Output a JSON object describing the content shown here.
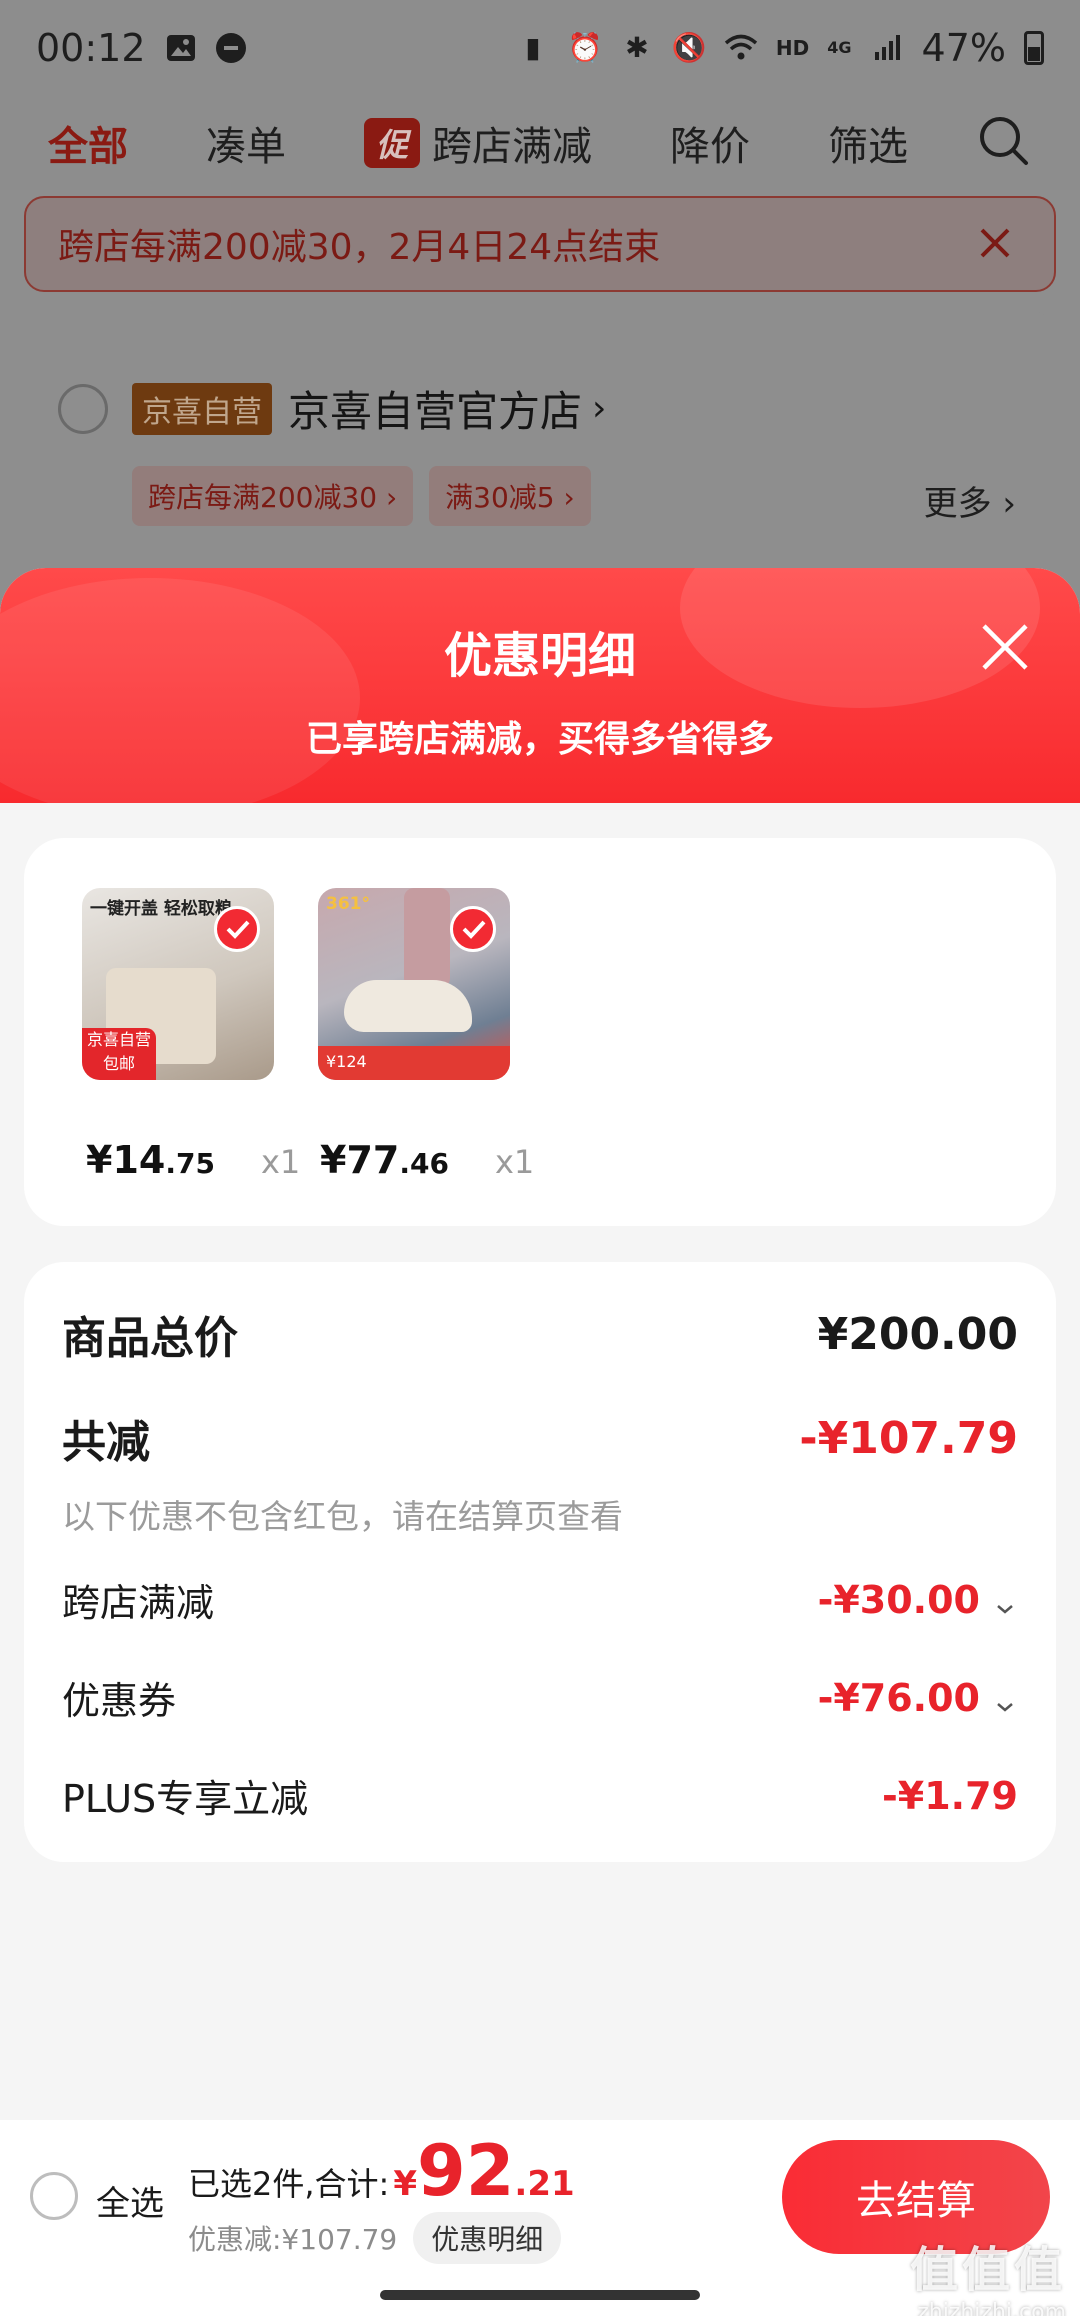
{
  "status_bar": {
    "time": "00:12",
    "network": "HD",
    "signal": "4G",
    "battery": "47%"
  },
  "top_nav": {
    "tabs": [
      "全部",
      "凑单",
      "跨店满减",
      "降价",
      "筛选"
    ],
    "promo_tag": "促",
    "active_index": 0
  },
  "banner": {
    "text": "跨店每满200减30，2月4日24点结束"
  },
  "shop": {
    "tag": "京喜自营",
    "name": "京喜自营官方店",
    "name_chevron": "›",
    "chips": [
      "跨店每满200减30 ›",
      "满30减5 ›"
    ],
    "more": "更多 ›"
  },
  "sheet": {
    "title": "优惠明细",
    "subtitle": "已享跨店满减，买得多省得多"
  },
  "products": [
    {
      "price_int": "¥14",
      "price_dec": ".75",
      "qty": "x1",
      "thumb_text": "一键开盖 轻松取粮",
      "thumb_badge": "京喜自营 包邮"
    },
    {
      "price_int": "¥77",
      "price_dec": ".46",
      "qty": "x1",
      "thumb_text": "361°",
      "thumb_badge": "¥124"
    }
  ],
  "summary": {
    "total_label": "商品总价",
    "total_value": "¥200.00",
    "reduce_label": "共减",
    "reduce_value": "-¥107.79",
    "note": "以下优惠不包含红包，请在结算页查看",
    "items": [
      {
        "label": "跨店满减",
        "value": "-¥30.00",
        "expandable": true
      },
      {
        "label": "优惠券",
        "value": "-¥76.00",
        "expandable": true
      },
      {
        "label": "PLUS专享立减",
        "value": "-¥1.79",
        "expandable": false
      }
    ]
  },
  "bottom_bar": {
    "select_all": "全选",
    "selected_text": "已选2件,合计:",
    "total_symbol": "¥",
    "total_int": "92",
    "total_dec": ".21",
    "discount_text": "优惠减:¥107.79",
    "detail_button": "优惠明细",
    "checkout": "去结算"
  },
  "watermark": {
    "brand": "值值值",
    "url": "zhizhizhi.com"
  },
  "colors": {
    "accent_red": "#e8232b",
    "header_red": "#f82a2e",
    "sheet_bg": "#f5f5f5"
  }
}
